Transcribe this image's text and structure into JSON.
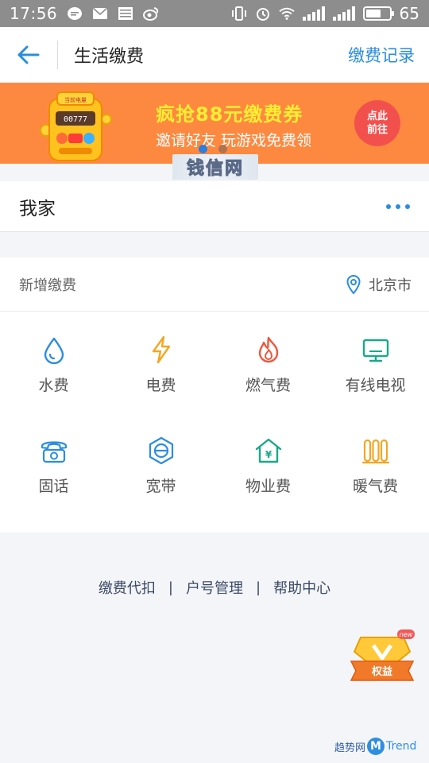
{
  "status_bar": {
    "time": "17:56",
    "battery": "65",
    "battery_level": 0.65,
    "icons": [
      "chat-icon",
      "mail-icon",
      "news-icon",
      "weibo-icon",
      "vibrate-icon",
      "alarm-icon",
      "wifi-icon",
      "signal-icon",
      "signal-icon",
      "battery-icon"
    ]
  },
  "nav": {
    "title": "生活缴费",
    "right_link": "缴费记录",
    "back_icon": "back-arrow-icon"
  },
  "banner": {
    "title": "疯抢88元缴费券",
    "subtitle": "邀请好友 玩游戏免费领",
    "cta_line1": "点此",
    "cta_line2": "前往",
    "machine_screen": "00777",
    "machine_top": "当前电量",
    "slide_count": 2,
    "active_slide": 1
  },
  "watermark_top": "钱信网",
  "home": {
    "title": "我家",
    "more_icon": "more-dots-icon"
  },
  "new_bill": {
    "title": "新增缴费",
    "location": "北京市",
    "location_icon": "location-pin-icon",
    "items": [
      {
        "label": "水费",
        "icon": "water-drop-icon",
        "color": "#2a8de0"
      },
      {
        "label": "电费",
        "icon": "lightning-icon",
        "color": "#f5a623"
      },
      {
        "label": "燃气费",
        "icon": "flame-icon",
        "color": "#f0573d"
      },
      {
        "label": "有线电视",
        "icon": "tv-icon",
        "color": "#1aa88a"
      },
      {
        "label": "固话",
        "icon": "telephone-icon",
        "color": "#2a8de0"
      },
      {
        "label": "宽带",
        "icon": "broadband-icon",
        "color": "#2a8de0"
      },
      {
        "label": "物业费",
        "icon": "property-house-icon",
        "color": "#1aa88a"
      },
      {
        "label": "暖气费",
        "icon": "radiator-icon",
        "color": "#f5a623"
      }
    ]
  },
  "footer": {
    "links": [
      "缴费代扣",
      "户号管理",
      "帮助中心"
    ],
    "separator": "|"
  },
  "float_badge": {
    "label": "权益",
    "tag": "new",
    "icon": "crown-badge-icon"
  },
  "watermark_bottom": {
    "text": "趋势网",
    "logo_letter": "M",
    "brand": "Trend"
  },
  "colors": {
    "accent": "#2a8de0",
    "banner_bg": "#fd8940",
    "banner_title": "#ffee33",
    "cta": "#f2504d"
  }
}
